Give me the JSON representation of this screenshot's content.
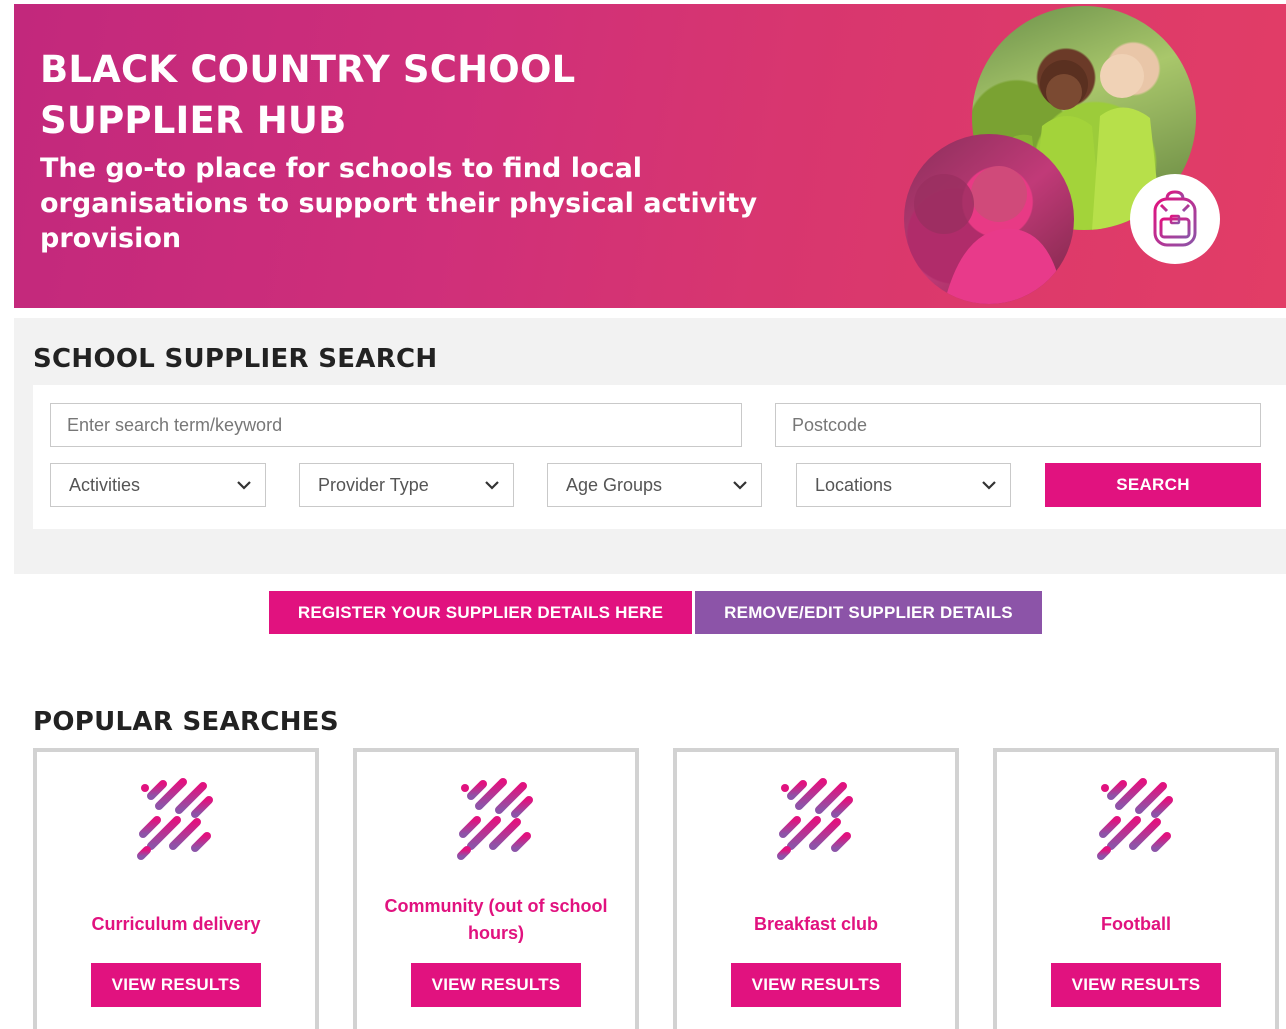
{
  "hero": {
    "title": "BLACK COUNTRY SCHOOL SUPPLIER HUB",
    "subtitle": "The go-to place for schools to find local organisations to support their physical activity provision",
    "badge_icon": "backpack-icon"
  },
  "search": {
    "heading": "SCHOOL SUPPLIER SEARCH",
    "keyword_placeholder": "Enter search term/keyword",
    "postcode_placeholder": "Postcode",
    "activities": "Activities",
    "provider_type": "Provider Type",
    "age_groups": "Age Groups",
    "locations": "Locations",
    "search_label": "SEARCH"
  },
  "actions": {
    "register_label": "REGISTER YOUR SUPPLIER DETAILS HERE",
    "remove_label": "REMOVE/EDIT SUPPLIER DETAILS"
  },
  "popular": {
    "heading": "POPULAR SEARCHES",
    "cards": [
      {
        "label": "Curriculum delivery",
        "button": "VIEW RESULTS"
      },
      {
        "label": "Community (out of school hours)",
        "button": "VIEW RESULTS"
      },
      {
        "label": "Breakfast club",
        "button": "VIEW RESULTS"
      },
      {
        "label": "Football",
        "button": "VIEW RESULTS"
      }
    ]
  },
  "colors": {
    "accent": "#e1127f",
    "secondary": "#8c54a8",
    "panel": "#f2f2f2"
  }
}
